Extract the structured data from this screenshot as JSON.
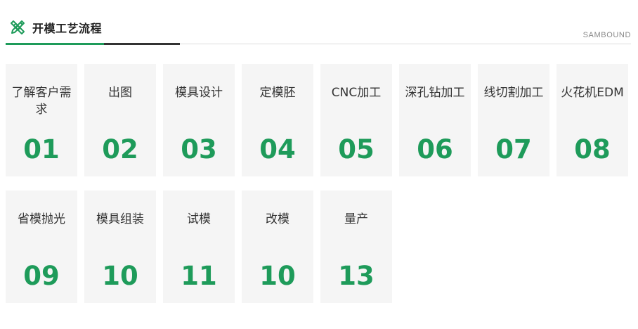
{
  "header": {
    "title": "开模工艺流程",
    "brand": "SAMBOUND",
    "icon": "ruler-pencil-icon",
    "accent_color": "#1e9b5a"
  },
  "steps": [
    {
      "label": "了解客户需求",
      "number": "01"
    },
    {
      "label": "出图",
      "number": "02"
    },
    {
      "label": "模具设计",
      "number": "03"
    },
    {
      "label": "定模胚",
      "number": "04"
    },
    {
      "label": "CNC加工",
      "number": "05"
    },
    {
      "label": "深孔钻加工",
      "number": "06"
    },
    {
      "label": "线切割加工",
      "number": "07"
    },
    {
      "label": "火花机EDM",
      "number": "08"
    },
    {
      "label": "省模抛光",
      "number": "09"
    },
    {
      "label": "模具组装",
      "number": "10"
    },
    {
      "label": "试模",
      "number": "11"
    },
    {
      "label": "改模",
      "number": "10"
    },
    {
      "label": "量产",
      "number": "13"
    }
  ]
}
